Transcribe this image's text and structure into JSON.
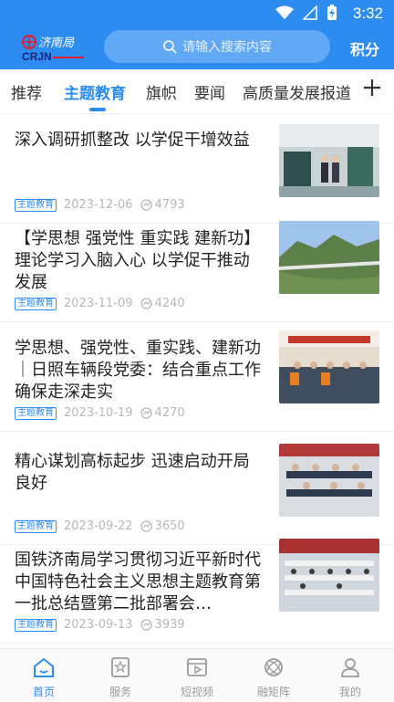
{
  "status": {
    "time": "3:32"
  },
  "header": {
    "logo_text": "济南局 CRJN",
    "search_placeholder": "请输入搜索内容",
    "points_label": "积分"
  },
  "tabs": [
    {
      "label": "推荐",
      "active": false
    },
    {
      "label": "主题教育",
      "active": true
    },
    {
      "label": "旗帜",
      "active": false
    },
    {
      "label": "要闻",
      "active": false
    },
    {
      "label": "高质量发展报道",
      "active": false
    }
  ],
  "articles": [
    {
      "title": "深入调研抓整改  以学促干增效益",
      "tag": "主题教育",
      "date": "2023-12-06",
      "views": "4793",
      "image": "factory-visit"
    },
    {
      "title": "【学思想  强党性  重实践  建新功】理论学习入脑入心  以学促干推动发展",
      "tag": "主题教育",
      "date": "2023-11-09",
      "views": "4240",
      "image": "bridge-landscape"
    },
    {
      "title": "学思想、强党性、重实践、建新功｜日照车辆段党委：结合重点工作  确保走深走实",
      "tag": "主题教育",
      "date": "2023-10-19",
      "views": "4270",
      "image": "meeting-hall"
    },
    {
      "title": "精心谋划高标起步  迅速启动开局良好",
      "tag": "主题教育",
      "date": "2023-09-22",
      "views": "3650",
      "image": "conference"
    },
    {
      "title": "国铁济南局学习贯彻习近平新时代中国特色社会主义思想主题教育第一批总结暨第二批部署会…",
      "tag": "主题教育",
      "date": "2023-09-13",
      "views": "3939",
      "image": "large-meeting"
    }
  ],
  "bottom_nav": [
    {
      "label": "首页",
      "icon": "home-icon",
      "active": true
    },
    {
      "label": "服务",
      "icon": "service-icon",
      "active": false
    },
    {
      "label": "短视频",
      "icon": "video-icon",
      "active": false
    },
    {
      "label": "融矩阵",
      "icon": "matrix-icon",
      "active": false
    },
    {
      "label": "我的",
      "icon": "profile-icon",
      "active": false
    }
  ],
  "colors": {
    "accent": "#2d8cf0"
  }
}
